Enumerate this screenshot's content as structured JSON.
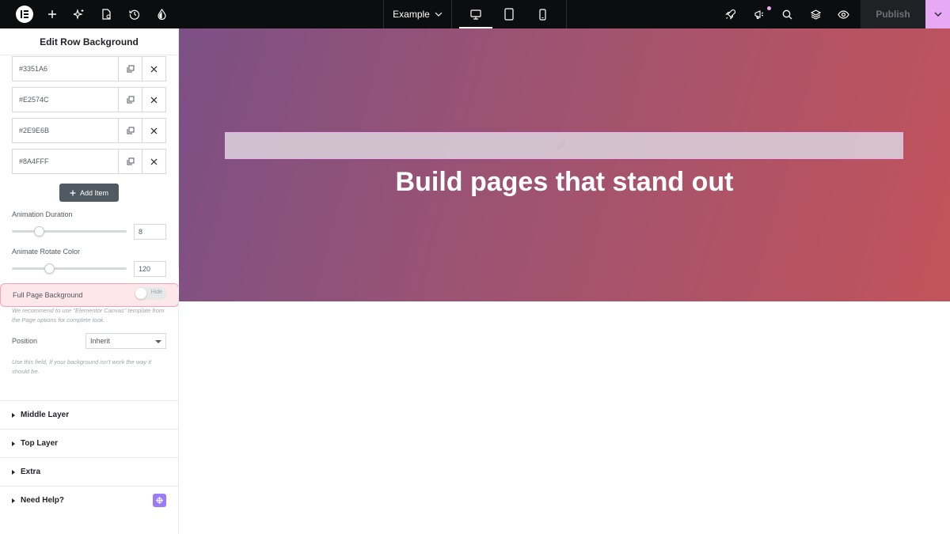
{
  "topbar": {
    "page_name": "Example",
    "publish_label": "Publish",
    "icons": [
      "elementor-logo-icon",
      "plus-icon",
      "ai-sparkle-icon",
      "page-settings-icon",
      "history-icon",
      "site-settings-drop-icon",
      "rocket-icon",
      "megaphone-icon",
      "search-icon",
      "layers-icon",
      "eye-icon",
      "chevron-down-icon"
    ],
    "devices": [
      "desktop",
      "tablet",
      "mobile"
    ],
    "active_device": "desktop"
  },
  "panel": {
    "title": "Edit Row Background",
    "colors": [
      "#3351A6",
      "#E2574C",
      "#2E9E6B",
      "#8A4FFF"
    ],
    "add_item_label": "Add Item",
    "animation_duration": {
      "label": "Animation Duration",
      "value": "8",
      "level": 0.24
    },
    "animate_rotate_color": {
      "label": "Animate Rotate Color",
      "value": "120",
      "level": 0.33
    },
    "full_page_background": {
      "label": "Full Page Background",
      "toggle_text": "Hide",
      "enabled": false
    },
    "full_page_note": "We recommend to use \"Elementor Canvas\" template from the Page options for complete look.",
    "position": {
      "label": "Position",
      "value": "Inherit"
    },
    "position_note": "Use this field, If your background isn't work the way it should be.",
    "sections": [
      {
        "label": "Middle Layer"
      },
      {
        "label": "Top Layer"
      },
      {
        "label": "Extra"
      },
      {
        "label": "Need Help?"
      }
    ]
  },
  "canvas": {
    "headline": "Build pages that stand out",
    "gradient_colors": [
      "#7b5085",
      "#9b5373",
      "#c2535b"
    ]
  }
}
